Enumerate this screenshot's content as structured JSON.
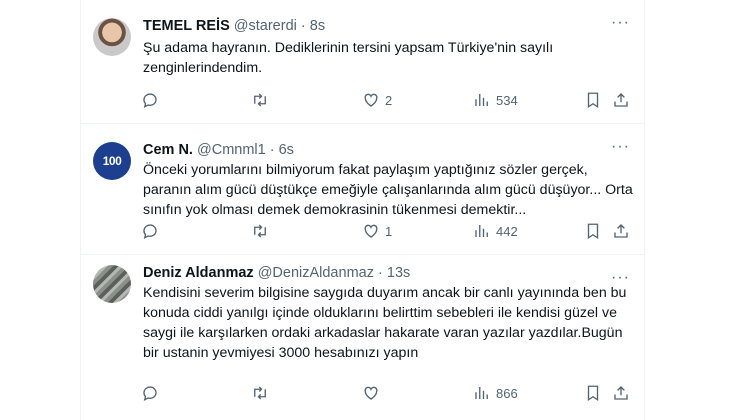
{
  "tweets": [
    {
      "name": "TEMEL REİS",
      "handle": "@starerdi",
      "time": "8s",
      "text": "Şu adama hayranın. Dediklerinin tersini yapsam Türkiye'nin sayılı zenginlerindendim.",
      "replies": "",
      "retweets": "",
      "likes": "2",
      "views": "534"
    },
    {
      "name": "Cem N.",
      "handle": "@Cmnml1",
      "time": "6s",
      "avatar_text": "100",
      "text": "Önceki yorumlarını bilmiyorum fakat paylaşım yaptığınız sözler gerçek, paranın alım gücü düştükçe emeğiyle çalışanlarında alım gücü düşüyor... Orta sınıfın yok olması demek demokrasinin tükenmesi demektir...",
      "replies": "",
      "retweets": "",
      "likes": "1",
      "views": "442"
    },
    {
      "name": "Deniz Aldanmaz",
      "handle": "@DenizAldanmaz",
      "time": "13s",
      "text": "Kendisini severim bilgisine saygıda duyarım ancak bir canlı yayınında ben bu konuda ciddi yanılgı içinde olduklarını belirttim sebebleri ile kendisi güzel ve saygi ile karşılarken ordaki arkadaslar hakarate varan yazılar yazdılar.Bugün bir ustanin yevmiyesi 3000 hesabınızı yapın",
      "replies": "",
      "retweets": "",
      "likes": "",
      "views": "866"
    }
  ],
  "separator": "·",
  "more_glyph": "···",
  "icons": [
    "reply-icon",
    "retweet-icon",
    "like-icon",
    "views-icon",
    "bookmark-icon",
    "share-icon",
    "more-icon"
  ],
  "colors": {
    "text": "#0f1419",
    "secondary": "#536471",
    "border": "#eff3f4"
  }
}
